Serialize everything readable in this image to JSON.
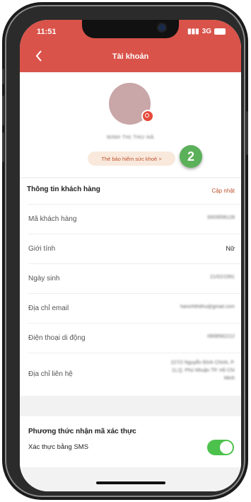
{
  "status_bar": {
    "time": "11:51",
    "signal": "3G"
  },
  "header": {
    "back_icon": "chevron-left-icon",
    "title": "Tài khoản"
  },
  "profile": {
    "name": "NINH THỊ THU HÀ",
    "insurance_button": "Thẻ bảo hiểm sức khoẻ >",
    "step_marker": "2"
  },
  "customer_info": {
    "title": "Thông tin khách hàng",
    "update_link": "Cập nhật",
    "rows": [
      {
        "label": "Mã khách hàng",
        "value": "0003558128"
      },
      {
        "label": "Giới tính",
        "value": "Nữ"
      },
      {
        "label": "Ngày sinh",
        "value": "21/02/1991"
      },
      {
        "label": "Địa chỉ email",
        "value": "haninhthithu@gmail.com"
      },
      {
        "label": "Điện thoại di động",
        "value": "0908582212"
      },
      {
        "label": "Địa chỉ liên hệ",
        "value": "227/2 Nguyễn Đình Chính, P. 11,Q. Phú Nhuận TP. Hồ Chí Minh"
      }
    ]
  },
  "verification": {
    "title": "Phương thức nhận mã xác thực",
    "sms_label": "Xác thực bằng SMS",
    "sms_enabled": true
  },
  "colors": {
    "accent": "#d9534a",
    "toggle_on": "#4cc24c",
    "step_badge": "#5bb05a"
  }
}
